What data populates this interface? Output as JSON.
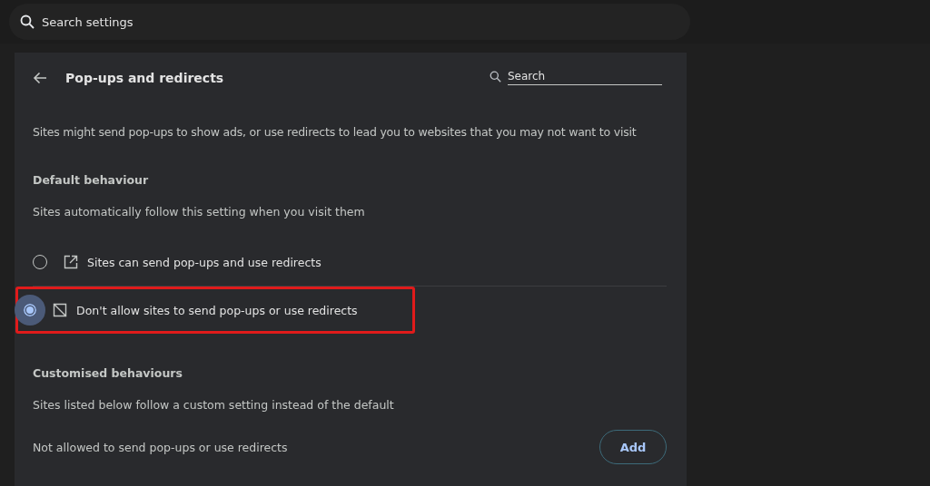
{
  "top_search": {
    "placeholder": "Search settings"
  },
  "page": {
    "title": "Pop-ups and redirects",
    "search": {
      "placeholder": "Search"
    },
    "description": "Sites might send pop-ups to show ads, or use redirects to lead you to websites that you may not want to visit"
  },
  "default_behaviour": {
    "heading": "Default behaviour",
    "subtitle": "Sites automatically follow this setting when you visit them",
    "options": [
      {
        "kind": "allow",
        "label": "Sites can send pop-ups and use redirects",
        "selected": false
      },
      {
        "kind": "block",
        "label": "Don't allow sites to send pop-ups or use redirects",
        "selected": true
      }
    ]
  },
  "customised_behaviours": {
    "heading": "Customised behaviours",
    "subtitle": "Sites listed below follow a custom setting instead of the default",
    "list_label": "Not allowed to send pop-ups or use redirects",
    "button": "Add"
  }
}
